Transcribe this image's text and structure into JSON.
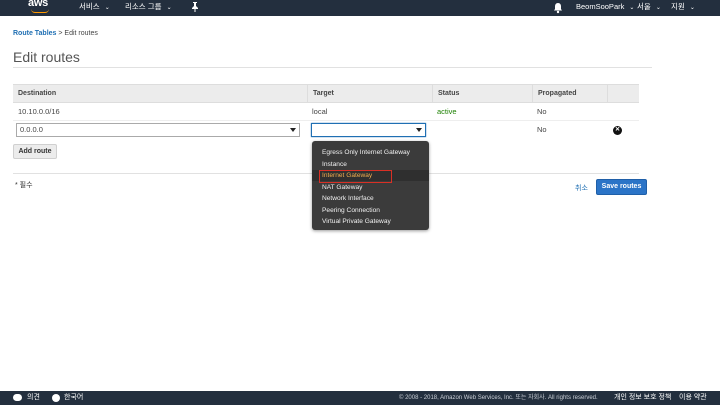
{
  "topbar": {
    "logo_text": "aws",
    "services_label": "서비스",
    "resource_groups_label": "리소스 그룹",
    "pin_icon": "pin-icon",
    "bell_icon": "bell-icon",
    "user_label": "BeomSooPark",
    "region_label": "서울",
    "support_label": "지원",
    "caret": "⌄"
  },
  "breadcrumb": {
    "parent": "Route Tables",
    "separator": " > ",
    "current": "Edit routes"
  },
  "page_title": "Edit routes",
  "table": {
    "headers": [
      "Destination",
      "Target",
      "Status",
      "Propagated"
    ],
    "rows": [
      {
        "destination": "10.10.0.0/16",
        "target": "local",
        "status": "active",
        "propagated": "No"
      },
      {
        "destination": "0.0.0.0",
        "target": "",
        "status": "",
        "propagated": "No"
      }
    ]
  },
  "add_route_label": "Add route",
  "required_label": "* 필수",
  "cancel_label": "취소",
  "save_label": "Save routes",
  "dropdown": {
    "options": [
      "Egress Only Internet Gateway",
      "Instance",
      "Internet Gateway",
      "NAT Gateway",
      "Network Interface",
      "Peering Connection",
      "Virtual Private Gateway"
    ],
    "highlighted": "Internet Gateway"
  },
  "footer": {
    "feedback_label": "의견",
    "language_label": "한국어",
    "copyright": "© 2008 - 2018, Amazon Web Services, Inc. 또는 자회사. All rights reserved.",
    "privacy_label": "개인 정보 보호 정책",
    "terms_label": "이용 약관"
  },
  "colors": {
    "nav_bg": "#232f3e",
    "accent_orange": "#ff9900",
    "link_blue": "#1f6fb3",
    "primary_button": "#2b74c7",
    "status_active": "#1d8102",
    "highlight_border": "#d93025"
  }
}
